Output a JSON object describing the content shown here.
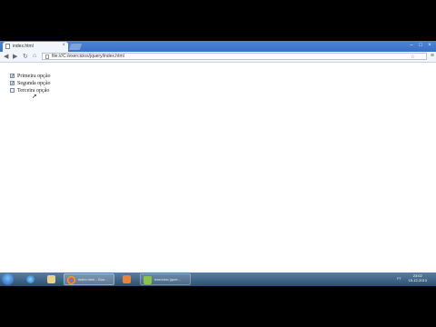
{
  "browser": {
    "tab_title": "index.html",
    "tab_close": "×",
    "url": "file:///C:/exercicios/jquery/index.html",
    "window_controls": [
      "–",
      "□",
      "×"
    ],
    "nav": {
      "back": "◀",
      "forward": "▶",
      "reload": "↻",
      "home": "⌂"
    },
    "star": "☆",
    "menu": "≡"
  },
  "page": {
    "options": [
      {
        "label": "Primeira opção",
        "checked": true
      },
      {
        "label": "Segunda opção",
        "checked": true
      },
      {
        "label": "Terceira opção",
        "checked": false
      }
    ]
  },
  "taskbar": {
    "items": [
      {
        "label": "",
        "icon": "internet-explorer-icon"
      },
      {
        "label": "",
        "icon": "file-explorer-icon"
      },
      {
        "label": "index.html - Goo...",
        "icon": "chrome-icon"
      },
      {
        "label": "",
        "icon": "media-player-icon"
      },
      {
        "label": "exercicio jquer...",
        "icon": "document-icon"
      }
    ],
    "clock_time": "23:02",
    "clock_date": "15-12-2013",
    "tray_lang": "PT"
  }
}
